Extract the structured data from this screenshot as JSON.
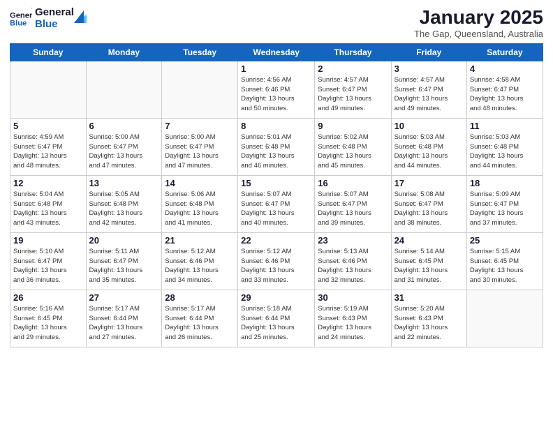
{
  "logo": {
    "line1": "General",
    "line2": "Blue"
  },
  "title": "January 2025",
  "subtitle": "The Gap, Queensland, Australia",
  "days_of_week": [
    "Sunday",
    "Monday",
    "Tuesday",
    "Wednesday",
    "Thursday",
    "Friday",
    "Saturday"
  ],
  "weeks": [
    [
      {
        "day": "",
        "info": ""
      },
      {
        "day": "",
        "info": ""
      },
      {
        "day": "",
        "info": ""
      },
      {
        "day": "1",
        "info": "Sunrise: 4:56 AM\nSunset: 6:46 PM\nDaylight: 13 hours\nand 50 minutes."
      },
      {
        "day": "2",
        "info": "Sunrise: 4:57 AM\nSunset: 6:47 PM\nDaylight: 13 hours\nand 49 minutes."
      },
      {
        "day": "3",
        "info": "Sunrise: 4:57 AM\nSunset: 6:47 PM\nDaylight: 13 hours\nand 49 minutes."
      },
      {
        "day": "4",
        "info": "Sunrise: 4:58 AM\nSunset: 6:47 PM\nDaylight: 13 hours\nand 48 minutes."
      }
    ],
    [
      {
        "day": "5",
        "info": "Sunrise: 4:59 AM\nSunset: 6:47 PM\nDaylight: 13 hours\nand 48 minutes."
      },
      {
        "day": "6",
        "info": "Sunrise: 5:00 AM\nSunset: 6:47 PM\nDaylight: 13 hours\nand 47 minutes."
      },
      {
        "day": "7",
        "info": "Sunrise: 5:00 AM\nSunset: 6:47 PM\nDaylight: 13 hours\nand 47 minutes."
      },
      {
        "day": "8",
        "info": "Sunrise: 5:01 AM\nSunset: 6:48 PM\nDaylight: 13 hours\nand 46 minutes."
      },
      {
        "day": "9",
        "info": "Sunrise: 5:02 AM\nSunset: 6:48 PM\nDaylight: 13 hours\nand 45 minutes."
      },
      {
        "day": "10",
        "info": "Sunrise: 5:03 AM\nSunset: 6:48 PM\nDaylight: 13 hours\nand 44 minutes."
      },
      {
        "day": "11",
        "info": "Sunrise: 5:03 AM\nSunset: 6:48 PM\nDaylight: 13 hours\nand 44 minutes."
      }
    ],
    [
      {
        "day": "12",
        "info": "Sunrise: 5:04 AM\nSunset: 6:48 PM\nDaylight: 13 hours\nand 43 minutes."
      },
      {
        "day": "13",
        "info": "Sunrise: 5:05 AM\nSunset: 6:48 PM\nDaylight: 13 hours\nand 42 minutes."
      },
      {
        "day": "14",
        "info": "Sunrise: 5:06 AM\nSunset: 6:48 PM\nDaylight: 13 hours\nand 41 minutes."
      },
      {
        "day": "15",
        "info": "Sunrise: 5:07 AM\nSunset: 6:47 PM\nDaylight: 13 hours\nand 40 minutes."
      },
      {
        "day": "16",
        "info": "Sunrise: 5:07 AM\nSunset: 6:47 PM\nDaylight: 13 hours\nand 39 minutes."
      },
      {
        "day": "17",
        "info": "Sunrise: 5:08 AM\nSunset: 6:47 PM\nDaylight: 13 hours\nand 38 minutes."
      },
      {
        "day": "18",
        "info": "Sunrise: 5:09 AM\nSunset: 6:47 PM\nDaylight: 13 hours\nand 37 minutes."
      }
    ],
    [
      {
        "day": "19",
        "info": "Sunrise: 5:10 AM\nSunset: 6:47 PM\nDaylight: 13 hours\nand 36 minutes."
      },
      {
        "day": "20",
        "info": "Sunrise: 5:11 AM\nSunset: 6:47 PM\nDaylight: 13 hours\nand 35 minutes."
      },
      {
        "day": "21",
        "info": "Sunrise: 5:12 AM\nSunset: 6:46 PM\nDaylight: 13 hours\nand 34 minutes."
      },
      {
        "day": "22",
        "info": "Sunrise: 5:12 AM\nSunset: 6:46 PM\nDaylight: 13 hours\nand 33 minutes."
      },
      {
        "day": "23",
        "info": "Sunrise: 5:13 AM\nSunset: 6:46 PM\nDaylight: 13 hours\nand 32 minutes."
      },
      {
        "day": "24",
        "info": "Sunrise: 5:14 AM\nSunset: 6:45 PM\nDaylight: 13 hours\nand 31 minutes."
      },
      {
        "day": "25",
        "info": "Sunrise: 5:15 AM\nSunset: 6:45 PM\nDaylight: 13 hours\nand 30 minutes."
      }
    ],
    [
      {
        "day": "26",
        "info": "Sunrise: 5:16 AM\nSunset: 6:45 PM\nDaylight: 13 hours\nand 29 minutes."
      },
      {
        "day": "27",
        "info": "Sunrise: 5:17 AM\nSunset: 6:44 PM\nDaylight: 13 hours\nand 27 minutes."
      },
      {
        "day": "28",
        "info": "Sunrise: 5:17 AM\nSunset: 6:44 PM\nDaylight: 13 hours\nand 26 minutes."
      },
      {
        "day": "29",
        "info": "Sunrise: 5:18 AM\nSunset: 6:44 PM\nDaylight: 13 hours\nand 25 minutes."
      },
      {
        "day": "30",
        "info": "Sunrise: 5:19 AM\nSunset: 6:43 PM\nDaylight: 13 hours\nand 24 minutes."
      },
      {
        "day": "31",
        "info": "Sunrise: 5:20 AM\nSunset: 6:43 PM\nDaylight: 13 hours\nand 22 minutes."
      },
      {
        "day": "",
        "info": ""
      }
    ]
  ]
}
